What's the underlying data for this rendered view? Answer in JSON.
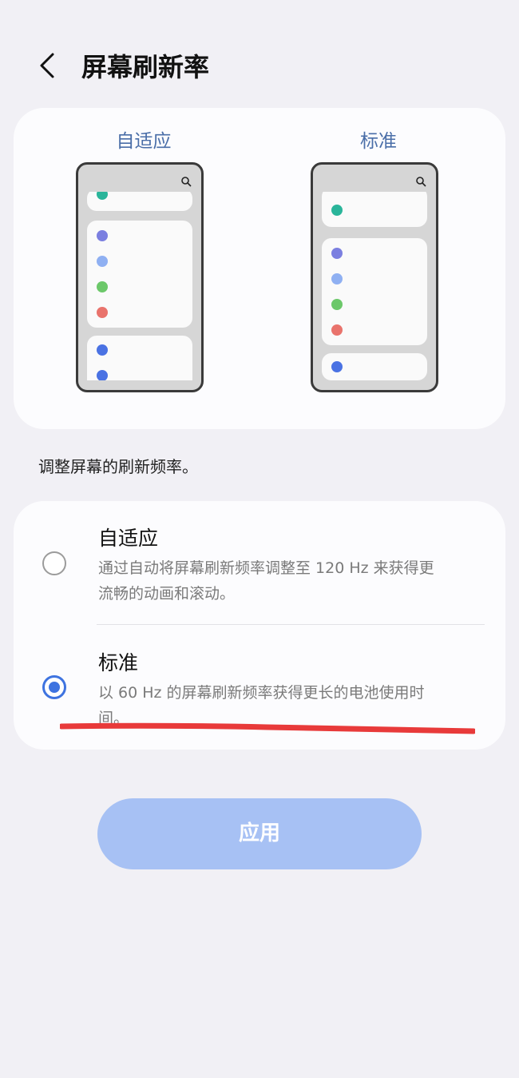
{
  "header": {
    "title": "屏幕刷新率",
    "back_icon": "chevron-left-icon"
  },
  "preview": {
    "adaptive_label": "自适应",
    "standard_label": "标准",
    "dot_colors": {
      "teal": "#2ab59a",
      "indigo": "#7b7fe0",
      "lightblue": "#8fb0f2",
      "green": "#6cc86a",
      "red": "#e9736c",
      "blue": "#4a72e3"
    }
  },
  "description": "调整屏幕的刷新频率。",
  "options": [
    {
      "title": "自适应",
      "subtitle_line1": "通过自动将屏幕刷新频率调整至 120 Hz 来获得更",
      "subtitle_line2": "流畅的动画和滚动。",
      "selected": false
    },
    {
      "title": "标准",
      "subtitle_line1": "以 60 Hz 的屏幕刷新频率获得更长的电池使用时",
      "subtitle_line2": "间。",
      "selected": true
    }
  ],
  "apply_label": "应用",
  "colors": {
    "accent": "#3e73e0",
    "apply_button": "#a7c1f4",
    "annotation": "#e83a3a"
  }
}
